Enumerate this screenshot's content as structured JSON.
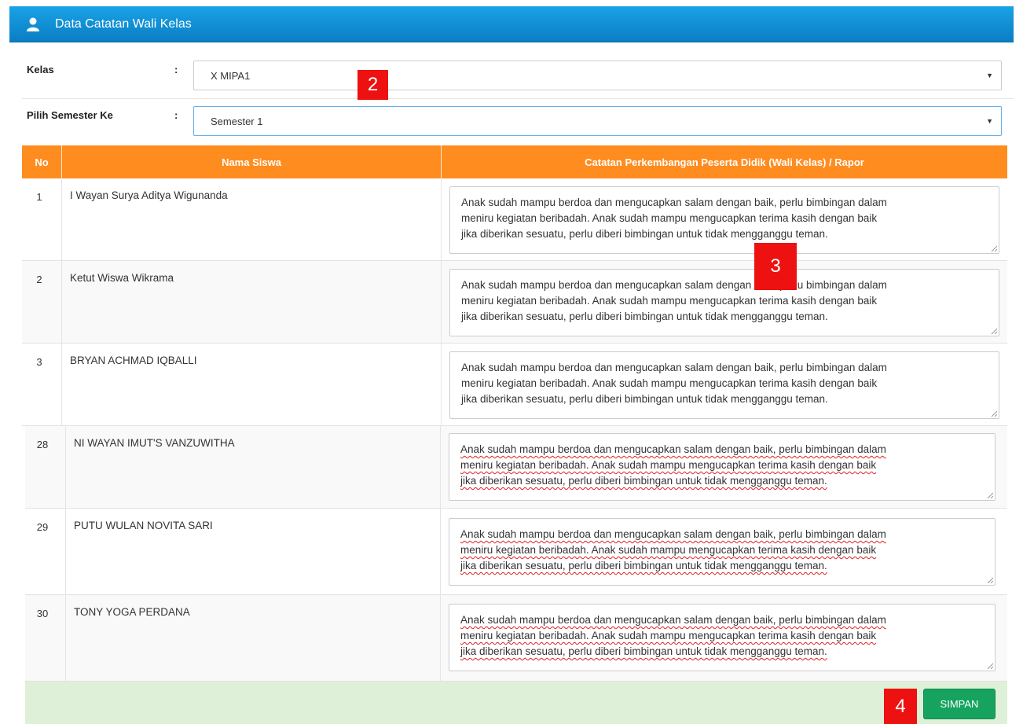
{
  "header": {
    "title": "Data Catatan Wali Kelas",
    "icon": "user-icon"
  },
  "form": {
    "kelas": {
      "label": "Kelas",
      "colon": ":",
      "value": "X MIPA1"
    },
    "semester": {
      "label": "Pilih Semester Ke",
      "colon": ":",
      "value": "Semester 1"
    }
  },
  "table": {
    "columns": [
      "No",
      "Nama Siswa",
      "Catatan Perkembangan Peserta Didik (Wali Kelas) / Rapor"
    ],
    "rows": [
      {
        "no": "1",
        "name": "I Wayan Surya Aditya Wigunanda",
        "note": [
          "Anak sudah mampu berdoa dan mengucapkan salam dengan baik, perlu bimbingan dalam",
          "meniru kegiatan beribadah. Anak sudah mampu mengucapkan terima kasih dengan baik",
          "jika diberikan sesuatu, perlu diberi bimbingan untuk tidak mengganggu teman."
        ]
      },
      {
        "no": "2",
        "name": "Ketut Wiswa Wikrama",
        "note": [
          "Anak sudah mampu berdoa dan mengucapkan salam dengan baik, perlu bimbingan dalam",
          "meniru kegiatan beribadah. Anak sudah mampu mengucapkan terima kasih dengan baik",
          "jika diberikan sesuatu, perlu diberi bimbingan untuk tidak mengganggu teman."
        ]
      },
      {
        "no": "3",
        "name": "BRYAN ACHMAD IQBALLI",
        "note": [
          "Anak sudah mampu berdoa dan mengucapkan salam dengan baik, perlu bimbingan dalam",
          "meniru kegiatan beribadah. Anak sudah mampu mengucapkan terima kasih dengan baik",
          "jika diberikan sesuatu, perlu diberi bimbingan untuk tidak mengganggu teman."
        ]
      },
      {
        "no": "28",
        "name": "NI WAYAN IMUT'S VANZUWITHA",
        "note": [
          "Anak sudah mampu berdoa dan mengucapkan salam dengan baik, perlu bimbingan dalam",
          "meniru kegiatan beribadah. Anak sudah mampu mengucapkan terima kasih dengan baik",
          "jika diberikan sesuatu, perlu diberi bimbingan untuk tidak mengganggu teman."
        ]
      },
      {
        "no": "29",
        "name": "PUTU WULAN NOVITA SARI",
        "note": [
          "Anak sudah mampu berdoa dan mengucapkan salam dengan baik, perlu bimbingan dalam",
          "meniru kegiatan beribadah. Anak sudah mampu mengucapkan terima kasih dengan baik",
          "jika diberikan sesuatu, perlu diberi bimbingan untuk tidak mengganggu teman."
        ]
      },
      {
        "no": "30",
        "name": "TONY YOGA PERDANA",
        "note": [
          "Anak sudah mampu berdoa dan mengucapkan salam dengan baik, perlu bimbingan dalam",
          "meniru kegiatan beribadah. Anak sudah mampu mengucapkan terima kasih dengan baik",
          "jika diberikan sesuatu, perlu diberi bimbingan untuk tidak mengganggu teman."
        ]
      }
    ]
  },
  "footer": {
    "save_label": "SIMPAN"
  },
  "annotations": [
    "2",
    "3",
    "4"
  ],
  "colors": {
    "header": "#0a7ec4",
    "table_header": "#ff8c1f",
    "save_button": "#16a35f",
    "footer_bg": "#dff0d8",
    "badge": "#ee1111"
  }
}
